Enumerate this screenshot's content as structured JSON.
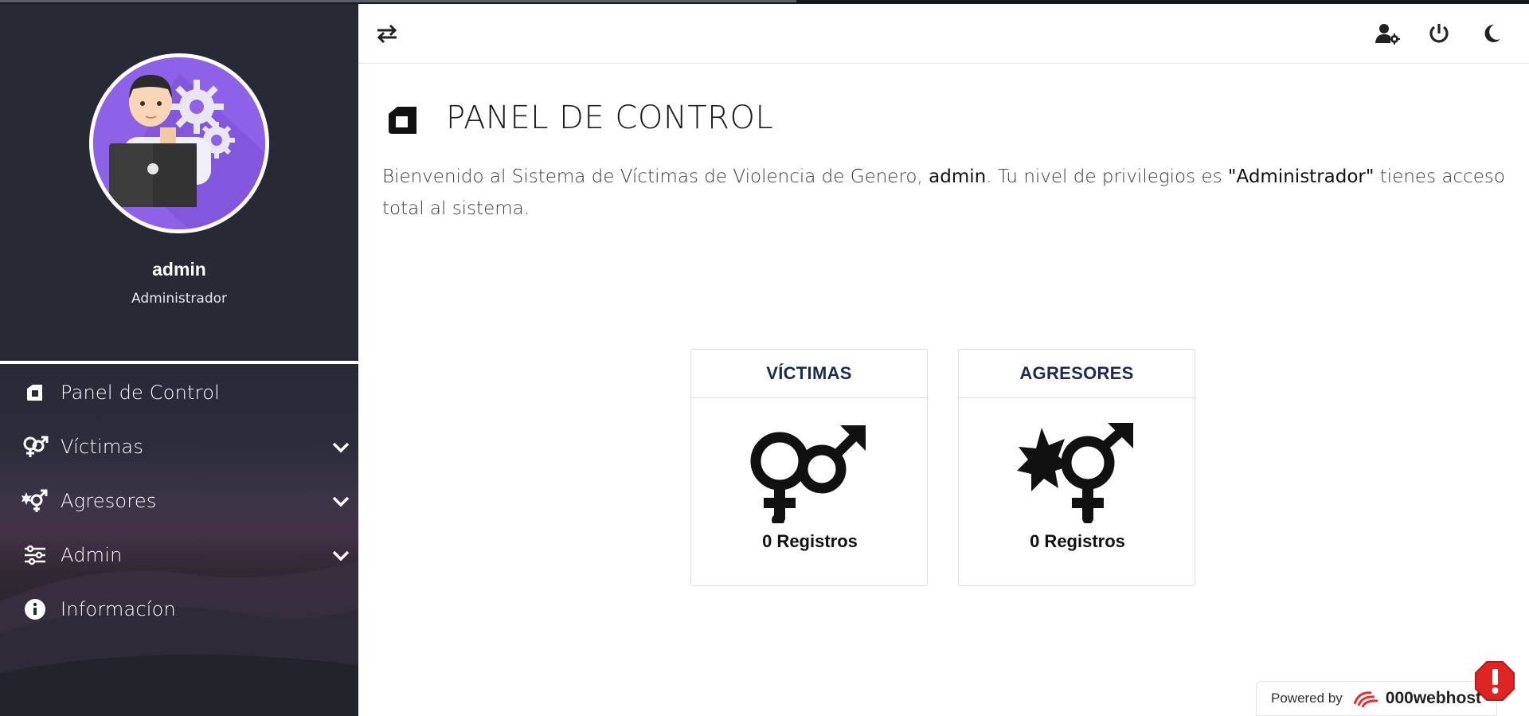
{
  "user": {
    "name": "admin",
    "role": "Administrador"
  },
  "sidebar": {
    "items": [
      {
        "label": "Panel de Control",
        "icon": "dashboard-icon",
        "expandable": false
      },
      {
        "label": "Víctimas",
        "icon": "gender-symbols-icon",
        "expandable": true
      },
      {
        "label": "Agresores",
        "icon": "aggressor-symbol-icon",
        "expandable": true
      },
      {
        "label": "Admin",
        "icon": "sliders-icon",
        "expandable": true
      },
      {
        "label": "Informacíon",
        "icon": "info-circle-icon",
        "expandable": false
      }
    ]
  },
  "topbar": {
    "toggle_icon": "swap-arrows-icon",
    "user_settings_icon": "user-gear-icon",
    "logout_icon": "power-icon",
    "theme_icon": "moon-icon"
  },
  "main": {
    "title": "PANEL DE CONTROL",
    "welcome_prefix": "Bienvenido al Sistema de Víctimas de Violencia de Genero, ",
    "welcome_user": "admin",
    "welcome_mid": ". Tu nivel de privilegios es ",
    "welcome_role": "\"Administrador\"",
    "welcome_suffix": " tienes acceso total al sistema."
  },
  "cards": [
    {
      "title": "VÍCTIMAS",
      "count": "0 Registros",
      "icon": "female-male-symbols-icon"
    },
    {
      "title": "AGRESORES",
      "count": "0 Registros",
      "icon": "explosion-gender-symbol-icon"
    }
  ],
  "footer": {
    "powered_label": "Powered by",
    "brand": "000webhost"
  },
  "colors": {
    "sidebar_bg": "#272935",
    "card_title": "#1d2a52",
    "alert": "#e02424",
    "avatar_bg": "#8d62e8"
  }
}
